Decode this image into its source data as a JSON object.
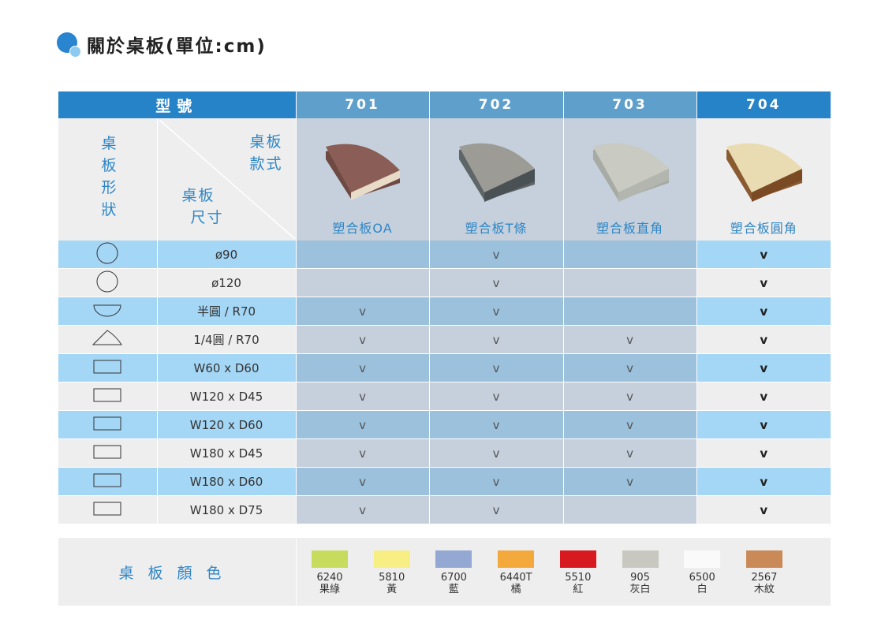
{
  "title": "關於桌板(單位:cm)",
  "header": {
    "type_label": "型號",
    "models": [
      "701",
      "702",
      "703",
      "704"
    ]
  },
  "corner": {
    "shape_label": [
      "桌",
      "板",
      "形",
      "狀"
    ],
    "style_label_1": "桌板",
    "style_label_2": "款式",
    "size_label_1": "桌板",
    "size_label_2": "尺寸"
  },
  "materials": [
    {
      "label": "塑合板OA",
      "icon": "laminate-sample-walnut"
    },
    {
      "label": "塑合板T條",
      "icon": "laminate-sample-gray-t-edge"
    },
    {
      "label": "塑合板直角",
      "icon": "laminate-sample-light-gray"
    },
    {
      "label": "塑合板圓角",
      "icon": "laminate-sample-beech"
    }
  ],
  "rows": [
    {
      "shape": "circle",
      "size": "ø90",
      "marks": [
        "",
        "v",
        "",
        "v"
      ]
    },
    {
      "shape": "circle",
      "size": "ø120",
      "marks": [
        "",
        "v",
        "",
        "v"
      ]
    },
    {
      "shape": "half-circle",
      "size": "半圓 / R70",
      "marks": [
        "v",
        "v",
        "",
        "v"
      ]
    },
    {
      "shape": "quarter-circle",
      "size": "1/4圓 / R70",
      "marks": [
        "v",
        "v",
        "v",
        "v"
      ]
    },
    {
      "shape": "rectangle",
      "size": "W60 x D60",
      "marks": [
        "v",
        "v",
        "v",
        "v"
      ]
    },
    {
      "shape": "rectangle",
      "size": "W120 x D45",
      "marks": [
        "v",
        "v",
        "v",
        "v"
      ]
    },
    {
      "shape": "rectangle",
      "size": "W120 x D60",
      "marks": [
        "v",
        "v",
        "v",
        "v"
      ]
    },
    {
      "shape": "rectangle",
      "size": "W180 x D45",
      "marks": [
        "v",
        "v",
        "v",
        "v"
      ]
    },
    {
      "shape": "rectangle",
      "size": "W180 x D60",
      "marks": [
        "v",
        "v",
        "v",
        "v"
      ]
    },
    {
      "shape": "rectangle",
      "size": "W180 x D75",
      "marks": [
        "v",
        "v",
        "",
        "v"
      ]
    }
  ],
  "colors_section": {
    "label": "桌板顏色",
    "swatches": [
      {
        "code": "6240",
        "name": "果綠",
        "color": "#c7db5c"
      },
      {
        "code": "5810",
        "name": "黃",
        "color": "#f7ee84"
      },
      {
        "code": "6700",
        "name": "藍",
        "color": "#93a8d3"
      },
      {
        "code": "6440T",
        "name": "橘",
        "color": "#f4a93d"
      },
      {
        "code": "5510",
        "name": "紅",
        "color": "#d71920"
      },
      {
        "code": "905",
        "name": "灰白",
        "color": "#c8c7c0"
      },
      {
        "code": "6500",
        "name": "白",
        "color": "#fafafa"
      },
      {
        "code": "2567",
        "name": "木紋",
        "color": "#c98a57"
      }
    ]
  },
  "theme": {
    "header_blue": "#2683c8",
    "header_light": "#5f9fcb",
    "row_blue": "#a4d6f5",
    "text_blue": "#2e86c6"
  }
}
